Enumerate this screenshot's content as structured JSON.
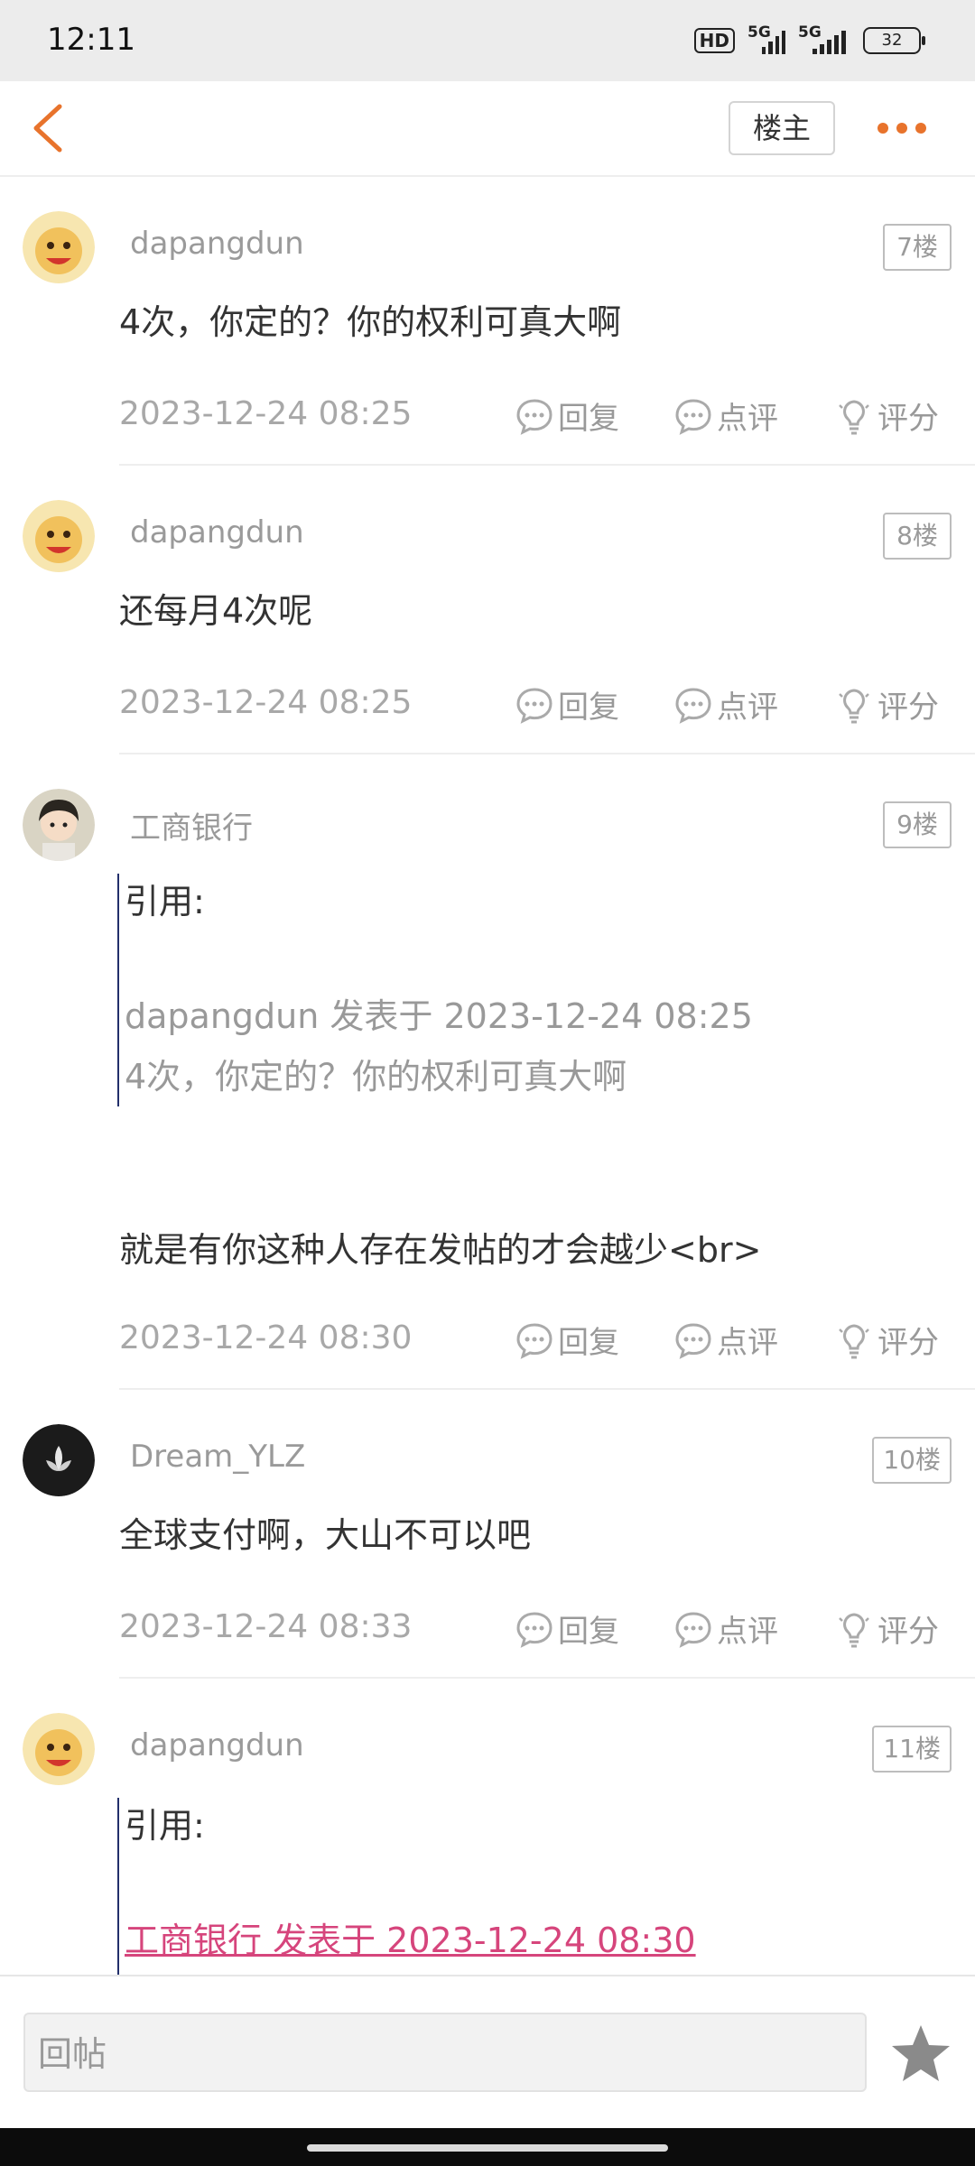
{
  "status_bar": {
    "time": "12:11",
    "hd": "HD",
    "net1": "5G",
    "net2": "5G",
    "battery": "32"
  },
  "nav": {
    "owner_label": "楼主"
  },
  "actions": {
    "reply": "回复",
    "comment": "点评",
    "rate": "评分"
  },
  "posts": [
    {
      "user": "dapangdun",
      "floor": "7楼",
      "text": "4次，你定的？你的权利可真大啊",
      "time": "2023-12-24 08:25"
    },
    {
      "user": "dapangdun",
      "floor": "8楼",
      "text": "还每月4次呢",
      "time": "2023-12-24 08:25"
    },
    {
      "user": "工商银行",
      "floor": "9楼",
      "quote": {
        "label": "引用:",
        "author_line": "dapangdun 发表于 2023-12-24 08:25",
        "quoted_text": "4次，你定的？你的权利可真大啊"
      },
      "text": "就是有你这种人存在发帖的才会越少<br>",
      "time": "2023-12-24 08:30"
    },
    {
      "user": "Dream_YLZ",
      "floor": "10楼",
      "text": "全球支付啊，大山不可以吧",
      "time": "2023-12-24 08:33"
    },
    {
      "user": "dapangdun",
      "floor": "11楼",
      "quote": {
        "label": "引用:",
        "author_line": "工商银行 发表于 2023-12-24 08:30"
      }
    }
  ],
  "bottom": {
    "reply_placeholder": "回帖"
  },
  "colors": {
    "accent": "#e8732c",
    "quote_link": "#d6457c",
    "quote_bar": "#222f6b"
  }
}
